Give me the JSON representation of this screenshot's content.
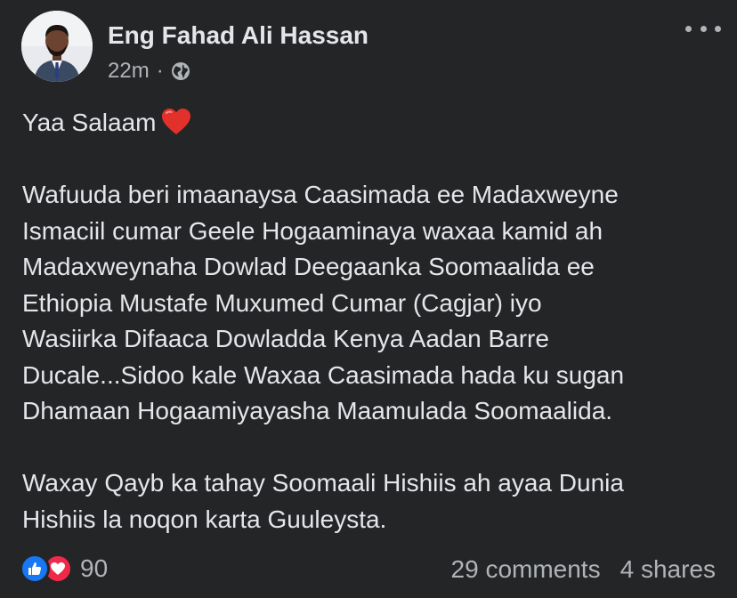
{
  "post": {
    "author": "Eng Fahad Ali Hassan",
    "time": "22m",
    "separator": "·",
    "privacy_icon": "globe-icon",
    "more_icon": "more-options-icon",
    "avatar_icon": "avatar"
  },
  "content": {
    "greeting": "Yaa Salaam",
    "greeting_emoji": "red-heart-icon",
    "paragraph_1": "Wafuuda beri imaanaysa Caasimada  ee Madaxweyne\nIsmaciil cumar Geele Hogaaminaya waxaa kamid ah\nMadaxweynaha Dowlad Deegaanka Soomaalida ee\nEthiopia Mustafe Muxumed Cumar (Cagjar) iyo\nWasiirka Difaaca Dowladda Kenya Aadan Barre\nDucale...Sidoo kale Waxaa Caasimada hada ku sugan\nDhamaan Hogaamiyayasha Maamulada Soomaalida.",
    "paragraph_2": "Waxay Qayb ka tahay Soomaali Hishiis ah ayaa Dunia\nHishiis la noqon karta Guuleysta."
  },
  "footer": {
    "reaction_count": "90",
    "comments": "29 comments",
    "shares": "4 shares",
    "reaction_icons": [
      "like-icon",
      "love-icon"
    ]
  },
  "colors": {
    "background": "#242526",
    "primary_text": "#e4e6eb",
    "secondary_text": "#b0b3b8",
    "like_blue": "#1877f2",
    "love_red": "#f02849"
  }
}
